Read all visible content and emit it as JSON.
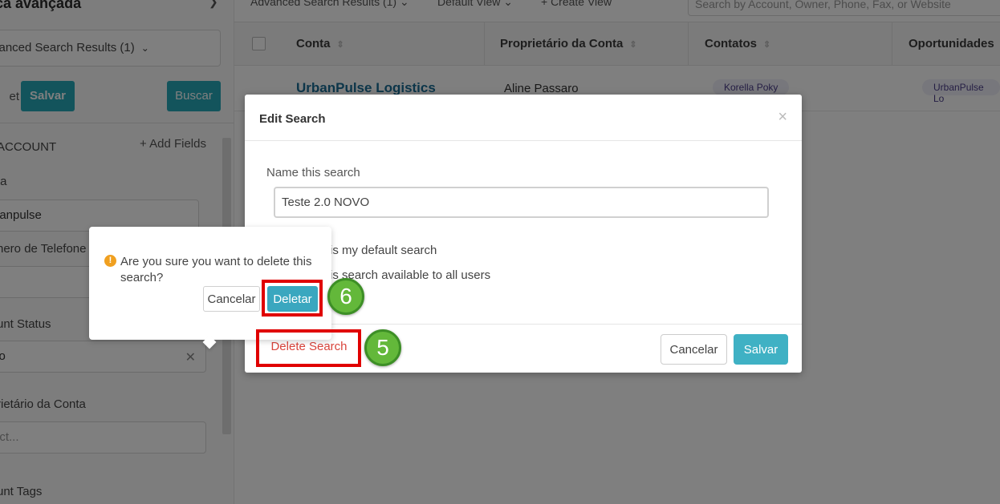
{
  "sidebar": {
    "title": "ca avançada",
    "results_dropdown": "vanced Search Results  (1)",
    "reset_label": "et",
    "save_label": "Salvar",
    "search_label": "Buscar",
    "section_title": "ACCOUNT",
    "add_fields_label": "+ Add Fields",
    "field_conta_label": "ta",
    "field_conta_value": "banpulse",
    "field_phone_label": "nero de Telefone",
    "field_status_label": "unt Status",
    "field_status_value": "vo",
    "field_owner_label": "rietário da Conta",
    "field_owner_placeholder": "ect...",
    "field_tags_label": "unt Tags"
  },
  "topbar": {
    "results_view": "Advanced Search Results (1)",
    "default_view": "Default View",
    "create_view": "+ Create View",
    "search_placeholder": "Search by Account, Owner, Phone, Fax, or Website"
  },
  "table": {
    "columns": [
      "Conta",
      "Proprietário da Conta",
      "Contatos",
      "Oportunidades"
    ],
    "row": {
      "conta": "UrbanPulse Logistics",
      "owner": "Aline Passaro",
      "contact": "Korella Poky",
      "opportunity": "UrbanPulse Lo"
    }
  },
  "modal": {
    "title": "Edit Search",
    "close_symbol": "×",
    "name_label": "Name this search",
    "name_value": "Teste 2.0 NOVO",
    "option_default": "is my default search",
    "option_share": "is search available to all users",
    "delete_search_label": "Delete Search",
    "cancel_label": "Cancelar",
    "save_label": "Salvar"
  },
  "confirm": {
    "message": "Are you sure you want to delete this search?",
    "cancel_label": "Cancelar",
    "delete_label": "Deletar"
  },
  "annotations": {
    "step_delete_search": "5",
    "step_confirm_delete": "6",
    "highlight_color": "#e00000",
    "step_color": "#63b83a"
  }
}
